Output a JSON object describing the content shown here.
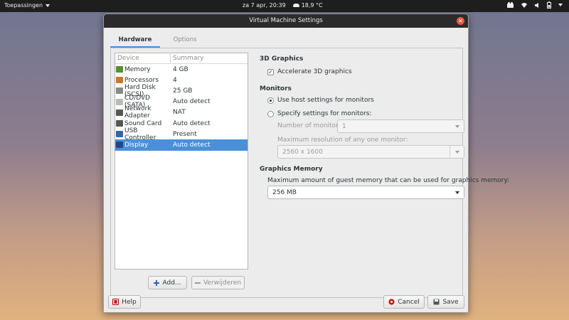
{
  "topbar": {
    "apps_label": "Toepassingen",
    "date": "za  7 apr, 20:39",
    "weather": "18,9 °C"
  },
  "window": {
    "title": "Virtual Machine Settings",
    "tabs": [
      {
        "label": "Hardware",
        "active": true
      },
      {
        "label": "Options",
        "active": false
      }
    ]
  },
  "device_list": {
    "headers": [
      "Device",
      "Summary"
    ],
    "rows": [
      {
        "device": "Memory",
        "summary": "4 GB",
        "icon": "memory-icon",
        "color": "#5a8f29"
      },
      {
        "device": "Processors",
        "summary": "4",
        "icon": "processor-icon",
        "color": "#c87a24"
      },
      {
        "device": "Hard Disk (SCSI)",
        "summary": "25 GB",
        "icon": "hard-disk-icon",
        "color": "#888a85"
      },
      {
        "device": "CD/DVD (SATA)",
        "summary": "Auto detect",
        "icon": "cd-icon",
        "color": "#babdb6"
      },
      {
        "device": "Network Adapter",
        "summary": "NAT",
        "icon": "network-icon",
        "color": "#555753"
      },
      {
        "device": "Sound Card",
        "summary": "Auto detect",
        "icon": "sound-icon",
        "color": "#555753"
      },
      {
        "device": "USB Controller",
        "summary": "Present",
        "icon": "usb-icon",
        "color": "#3465a4"
      },
      {
        "device": "Display",
        "summary": "Auto detect",
        "icon": "display-icon",
        "color": "#204a87",
        "selected": true
      }
    ],
    "add_button": "Add...",
    "remove_button": "Verwijderen"
  },
  "display": {
    "graphics3d": {
      "title": "3D Graphics",
      "accelerate_label": "Accelerate 3D graphics",
      "accelerate_checked": true
    },
    "monitors": {
      "title": "Monitors",
      "host_label": "Use host settings for monitors",
      "specify_label": "Specify settings for monitors:",
      "selected": "host",
      "number_label": "Number of monitors:",
      "number_value": "1",
      "maxres_label": "Maximum resolution of any one monitor:",
      "maxres_value": "2560 x 1600"
    },
    "graphics_memory": {
      "title": "Graphics Memory",
      "desc": "Maximum amount of guest memory that can be used for graphics memory:",
      "value": "256 MB"
    }
  },
  "footer": {
    "help": "Help",
    "cancel": "Cancel",
    "save": "Save"
  },
  "colors": {
    "accent": "#4a90d9",
    "titlebar": "#2b2b2b",
    "close": "#e8583f"
  }
}
